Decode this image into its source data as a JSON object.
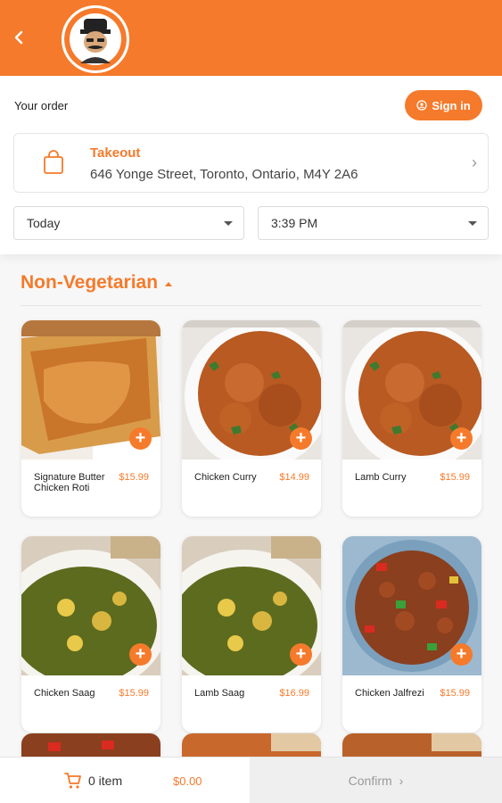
{
  "header": {
    "back_icon": "chevron-left-icon",
    "logo_icon": "chef-mascot-logo",
    "brand_color": "#f57a2b"
  },
  "order": {
    "title": "Your order",
    "signin_label": "Sign in",
    "takeout_title": "Takeout",
    "takeout_address": "646 Yonge Street, Toronto, Ontario, M4Y 2A6",
    "date_value": "Today",
    "time_value": "3:39 PM"
  },
  "menu": {
    "section_title": "Non-Vegetarian",
    "items": [
      {
        "name": "Signature Butter Chicken Roti",
        "price": "$15.99"
      },
      {
        "name": "Chicken Curry",
        "price": "$14.99"
      },
      {
        "name": "Lamb Curry",
        "price": "$15.99"
      },
      {
        "name": "Chicken Saag",
        "price": "$15.99"
      },
      {
        "name": "Lamb Saag",
        "price": "$16.99"
      },
      {
        "name": "Chicken Jalfrezi",
        "price": "$15.99"
      }
    ],
    "add_symbol": "+"
  },
  "cart": {
    "count_label": "0 item",
    "total": "$0.00",
    "confirm_label": "Confirm",
    "confirm_chevron": "›"
  }
}
